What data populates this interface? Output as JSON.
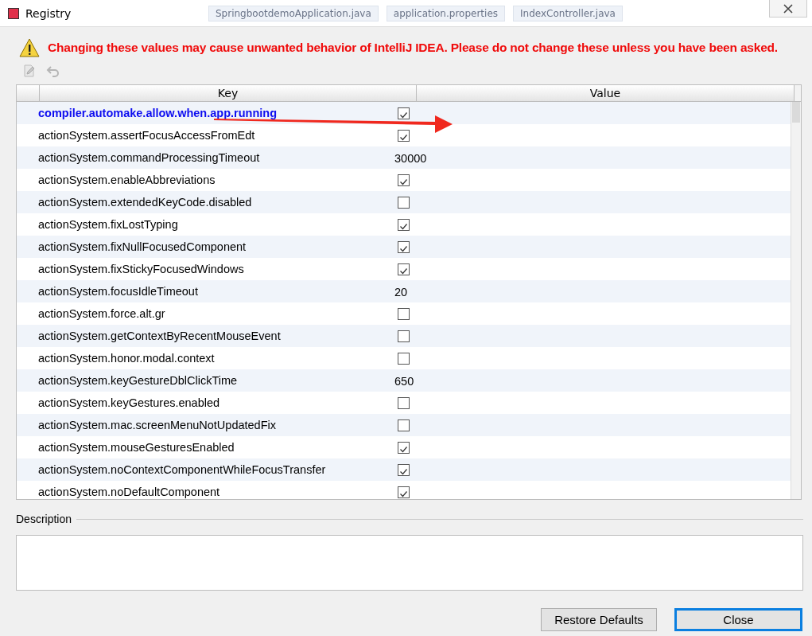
{
  "window": {
    "title": "Registry",
    "background_tabs": [
      "SpringbootdemoApplication.java",
      "application.properties",
      "IndexController.java"
    ]
  },
  "warning": "Changing these values may cause unwanted behavior of IntelliJ IDEA. Please do not change these unless you have been asked.",
  "table": {
    "columns": [
      "Key",
      "Value"
    ],
    "rows": [
      {
        "key": "compiler.automake.allow.when.app.running",
        "modified": true,
        "kind": "checkbox",
        "checked": true
      },
      {
        "key": "actionSystem.assertFocusAccessFromEdt",
        "modified": false,
        "kind": "checkbox",
        "checked": true
      },
      {
        "key": "actionSystem.commandProcessingTimeout",
        "modified": false,
        "kind": "text",
        "value": "30000"
      },
      {
        "key": "actionSystem.enableAbbreviations",
        "modified": false,
        "kind": "checkbox",
        "checked": true
      },
      {
        "key": "actionSystem.extendedKeyCode.disabled",
        "modified": false,
        "kind": "checkbox",
        "checked": false
      },
      {
        "key": "actionSystem.fixLostTyping",
        "modified": false,
        "kind": "checkbox",
        "checked": true
      },
      {
        "key": "actionSystem.fixNullFocusedComponent",
        "modified": false,
        "kind": "checkbox",
        "checked": true
      },
      {
        "key": "actionSystem.fixStickyFocusedWindows",
        "modified": false,
        "kind": "checkbox",
        "checked": true
      },
      {
        "key": "actionSystem.focusIdleTimeout",
        "modified": false,
        "kind": "text",
        "value": "20"
      },
      {
        "key": "actionSystem.force.alt.gr",
        "modified": false,
        "kind": "checkbox",
        "checked": false
      },
      {
        "key": "actionSystem.getContextByRecentMouseEvent",
        "modified": false,
        "kind": "checkbox",
        "checked": false
      },
      {
        "key": "actionSystem.honor.modal.context",
        "modified": false,
        "kind": "checkbox",
        "checked": false
      },
      {
        "key": "actionSystem.keyGestureDblClickTime",
        "modified": false,
        "kind": "text",
        "value": "650"
      },
      {
        "key": "actionSystem.keyGestures.enabled",
        "modified": false,
        "kind": "checkbox",
        "checked": false
      },
      {
        "key": "actionSystem.mac.screenMenuNotUpdatedFix",
        "modified": false,
        "kind": "checkbox",
        "checked": false
      },
      {
        "key": "actionSystem.mouseGesturesEnabled",
        "modified": false,
        "kind": "checkbox",
        "checked": true
      },
      {
        "key": "actionSystem.noContextComponentWhileFocusTransfer",
        "modified": false,
        "kind": "checkbox",
        "checked": true
      },
      {
        "key": "actionSystem.noDefaultComponent",
        "modified": false,
        "kind": "checkbox",
        "checked": true
      }
    ]
  },
  "description": {
    "label": "Description"
  },
  "buttons": [
    {
      "label": "Restore Defaults",
      "focused": false
    },
    {
      "label": "Close",
      "focused": true
    }
  ]
}
